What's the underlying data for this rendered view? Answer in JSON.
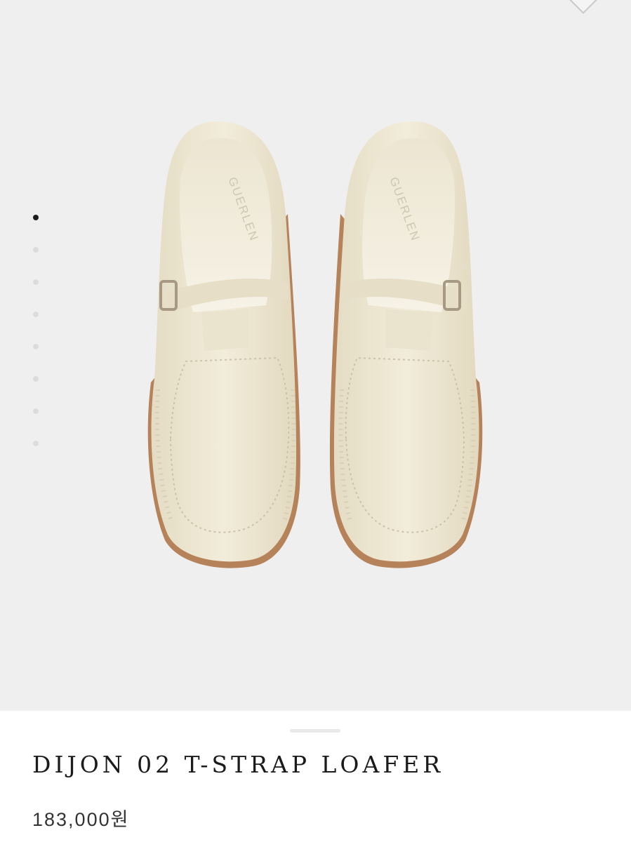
{
  "gallery": {
    "slide_count": 8,
    "active_index": 0,
    "background": "#efefef",
    "icons": {
      "wishlist": "diamond-outline-icon"
    },
    "image": {
      "subject": "pair of cream t-strap loafers",
      "colors": {
        "leather": "#ede6d0",
        "leather_shadow": "#d9cfb4",
        "insole": "#f3efe2",
        "sole_edge": "#b5825a",
        "buckle": "#a89a82"
      }
    }
  },
  "product": {
    "name": "DIJON 02 T-STRAP LOAFER",
    "price": "183,000원"
  }
}
